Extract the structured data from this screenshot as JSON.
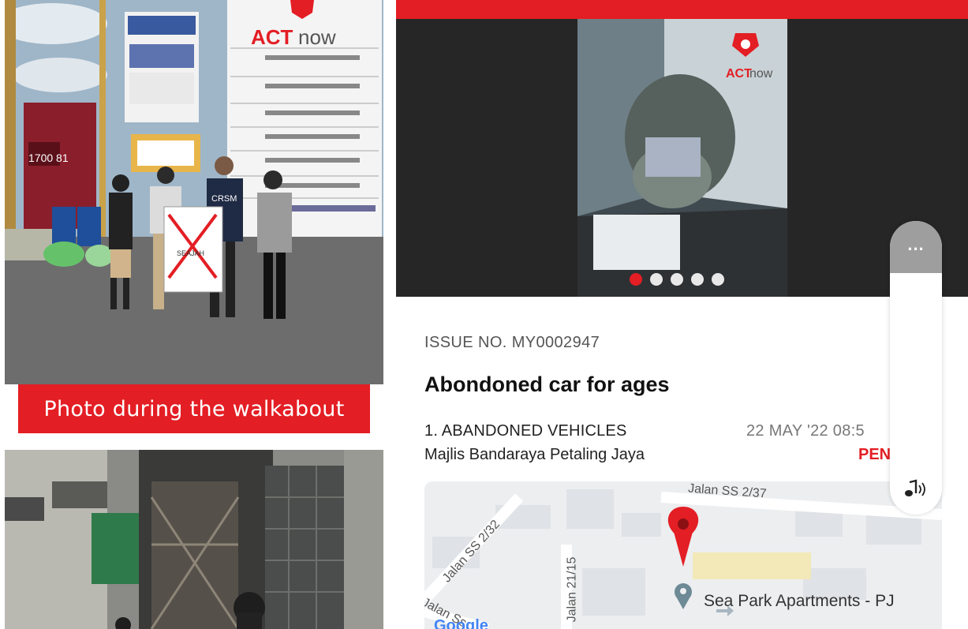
{
  "caption": {
    "text": "Photo during the walkabout",
    "color": "#e31e24"
  },
  "photos": {
    "walkabout_brand": "ACTnow",
    "poster_text": "SEAJAH",
    "shirt_text": "CRSM"
  },
  "app": {
    "accent_color": "#e31e24",
    "gallery": {
      "watermark": "ACTnow",
      "pages": 5,
      "active_page": 1
    },
    "issue": {
      "number": "ISSUE NO. MY0002947",
      "title": "Abondoned car for ages",
      "category": "1. ABANDONED VEHICLES",
      "date": "22 MAY '22 08:5",
      "council": "Majlis Bandaraya Petaling Jaya",
      "status": "PEN"
    },
    "map": {
      "street_1": "Jalan SS 2/37",
      "street_2": "Jalan SS 2/32",
      "street_3": "Jalan 21/15",
      "street_4": "Jalan Ss",
      "poi": "Sea Park Apartments - PJ",
      "google_logo": "Google"
    },
    "float_menu": {
      "more_icon": "ellipsis-icon",
      "more_label": "...",
      "audio_icon": "music-audio-icon"
    }
  }
}
